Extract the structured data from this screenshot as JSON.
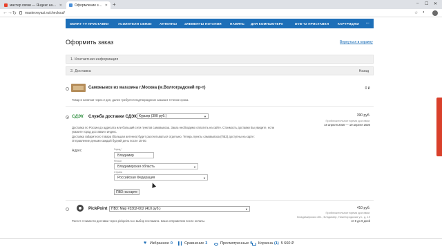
{
  "browser": {
    "tabs": [
      {
        "title": "мастер связи — Яндекс нашел...",
        "favicon_color": "#e8412b"
      },
      {
        "title": "Оформление заказа - Контакт...",
        "favicon_color": "#4a90d9"
      }
    ],
    "new_tab": "+",
    "url": "masterxvyazi.ru/checkout/"
  },
  "nav": {
    "items": [
      "SMART TV ПРИСТАВКИ",
      "УСИЛИТЕЛИ СВЯЗИ",
      "АНТЕННЫ",
      "ЭЛЕМЕНТЫ ПИТАНИЯ",
      "ПАМЯТЬ",
      "ДЛЯ КОМПЬЮТЕРА",
      "DVB-T2 ПРИСТАВКИ",
      "КАРТРИДЖИ"
    ],
    "more": "⋯"
  },
  "page": {
    "title": "Оформить заказ",
    "back_to_cart": "Вернуться в корзину"
  },
  "steps": {
    "contact": "1. Контактная информация",
    "delivery": "2. Доставка",
    "back": "Назад"
  },
  "pickup": {
    "title": "Самовывоз из магазина г.Москва (м.Волгоградский пр-т)",
    "note": "Товар в наличии через 2 дня, далее требуется подтверждение заказа в течение срока.",
    "price": "0 ₽"
  },
  "cdek": {
    "logo": "СДЭК",
    "title": "Служба доставки СДЭК",
    "select_value": "Курьер (390 руб.)",
    "price": "390 руб.",
    "est_label": "Приблизительное время доставки:",
    "est_dates": "18 апреля 2020 — 19 апреля 2020",
    "desc_lines": [
      "Доставка по России до адресата или больший сети пунктов самовывоза. Заказ необходимо оплатить на сайте. Стоимость доставки Вы увидите, если",
      "укажите город доставки и индекс.",
      "Доставка габаритного товара (большая антенна) будет рассчитываться отдельно. Теперь пункты самовывоза (ПВЗ) доступны на карте:",
      "Отправление деньми каждый будний день после 15-00."
    ],
    "address_label": "Адрес",
    "fields": {
      "city_label": "Город *",
      "city_value": "Владимир",
      "region_label": "Регион",
      "region_value": "Владимирская область",
      "country_label": "Страна",
      "country_value": "Российская Федерация"
    },
    "map_button": "ПВЗ на карте"
  },
  "pickpoint": {
    "title": "PickPoint",
    "select_value": "ПВЗ: Мир #3302-002 (410 руб.)",
    "price": "410 руб.",
    "est_label": "Приблизительное время доставки:",
    "address": "Владимирская обл., Владимир, Нижегородская ул., д. 19",
    "eta": "от 8 до 9 дней",
    "note": "Расчет стоимости доставки через pickpoint.ru и выбор постамата. Заказ отправляем после оплаты."
  },
  "bottom": {
    "favorites_label": "Избранное",
    "favorites_count": "0",
    "compare_label": "Сравнение",
    "compare_count": "3",
    "viewed_label": "Просмотренные",
    "viewed_count": "9",
    "cart_label": "Корзина",
    "cart_count": "(1)",
    "cart_total": "5 660 ₽"
  },
  "colors": {
    "nav_blue": "#1d6fb8",
    "feedback_red": "#d9402b",
    "cdek_green": "#2a8c3a"
  }
}
